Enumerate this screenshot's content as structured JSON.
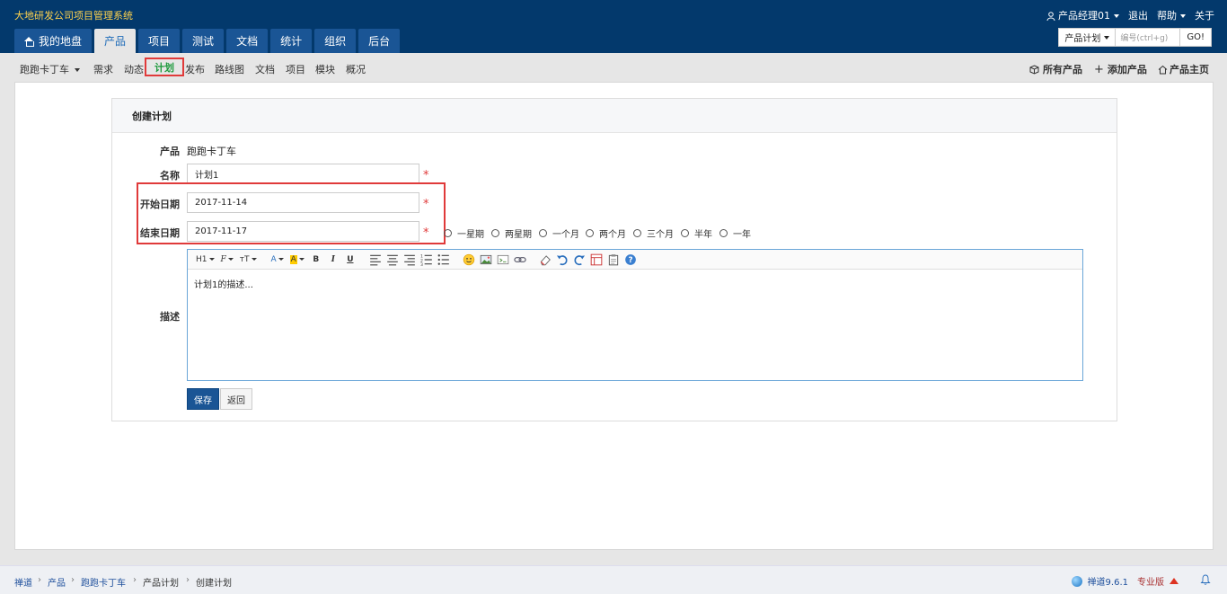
{
  "app": {
    "company": "大地研发公司项目管理系统",
    "user": "产品经理01",
    "logout": "退出",
    "help": "帮助",
    "about": "关于"
  },
  "nav": {
    "tabs": [
      "我的地盘",
      "产品",
      "项目",
      "测试",
      "文档",
      "统计",
      "组织",
      "后台"
    ],
    "active": "产品"
  },
  "search": {
    "type": "产品计划",
    "placeholder": "编号(ctrl+g)",
    "go": "GO!"
  },
  "subnav": {
    "product": "跑跑卡丁车",
    "items": [
      "需求",
      "动态",
      "计划",
      "发布",
      "路线图",
      "文档",
      "项目",
      "模块",
      "概况"
    ],
    "active": "计划",
    "right": [
      "所有产品",
      "添加产品",
      "产品主页"
    ]
  },
  "form": {
    "title": "创建计划",
    "product_label": "产品",
    "product_value": "跑跑卡丁车",
    "name_label": "名称",
    "name_value": "计划1",
    "begin_label": "开始日期",
    "begin_value": "2017-11-14",
    "end_label": "结束日期",
    "end_value": "2017-11-17",
    "required_mark": "*",
    "durations": [
      "一星期",
      "两星期",
      "一个月",
      "两个月",
      "三个月",
      "半年",
      "一年"
    ],
    "desc_label": "描述",
    "desc_value": "计划1的描述...",
    "save": "保存",
    "back": "返回"
  },
  "editor_toolbar": {
    "items": [
      "H1",
      "F",
      "тT",
      "A",
      "A",
      "B",
      "I",
      "U"
    ]
  },
  "footer": {
    "breadcrumb": [
      "禅道",
      "产品",
      "跑跑卡丁车",
      "产品计划",
      "创建计划"
    ],
    "version": "禅道9.6.1",
    "edition": "专业版"
  },
  "colors": {
    "header": "#03396c",
    "nav_tab": "#1a5595",
    "highlight": "#e03a3a",
    "active_green": "#1e9a3d"
  }
}
